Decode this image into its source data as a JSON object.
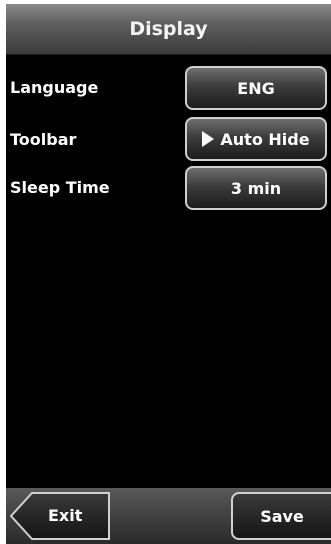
{
  "header": {
    "title": "Display"
  },
  "settings": [
    {
      "label": "Language",
      "value": "ENG"
    },
    {
      "label": "Toolbar",
      "value": "Auto Hide"
    },
    {
      "label": "Sleep Time",
      "value": "3 min"
    }
  ],
  "footer": {
    "exit_label": "Exit",
    "save_label": "Save"
  },
  "colors": {
    "background": "#000000",
    "text": "#ffffff",
    "button_border": "#cfcfcf"
  }
}
